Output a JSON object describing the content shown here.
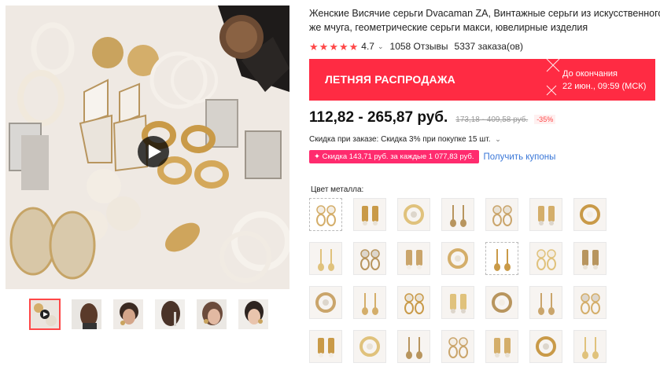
{
  "product": {
    "title": "Женские Висячие серьги Dvacaman ZA, Винтажные серьги из искусственного же мчуга, геометрические серьги макси, ювелирные изделия",
    "rating_value": "4.7",
    "reviews": "1058 Отзывы",
    "orders": "5337 заказа(ов)"
  },
  "sale_banner": {
    "label": "ЛЕТНЯЯ РАСПРОДАЖА",
    "countdown_line1": "До окончания",
    "countdown_line2": "22 июн., 09:59 (МСК)"
  },
  "price": {
    "current": "112,82 - 265,87 руб.",
    "original": "173,18 - 409,58 руб.",
    "discount": "-35%"
  },
  "bulk_discount": "Скидка при заказе: Скидка 3% при покупке 15 шт.",
  "coupon": {
    "tag": "✦ Скидка 143,71 руб. за каждые 1 077,83 руб.",
    "link": "Получить купоны"
  },
  "metal_label": "Цвет металла:",
  "colors": {
    "accent": "#ff2b43",
    "link": "#3a77d8",
    "coupon": "#ff2b6e"
  },
  "swatch_count": 28,
  "thumbnail_count": 6
}
